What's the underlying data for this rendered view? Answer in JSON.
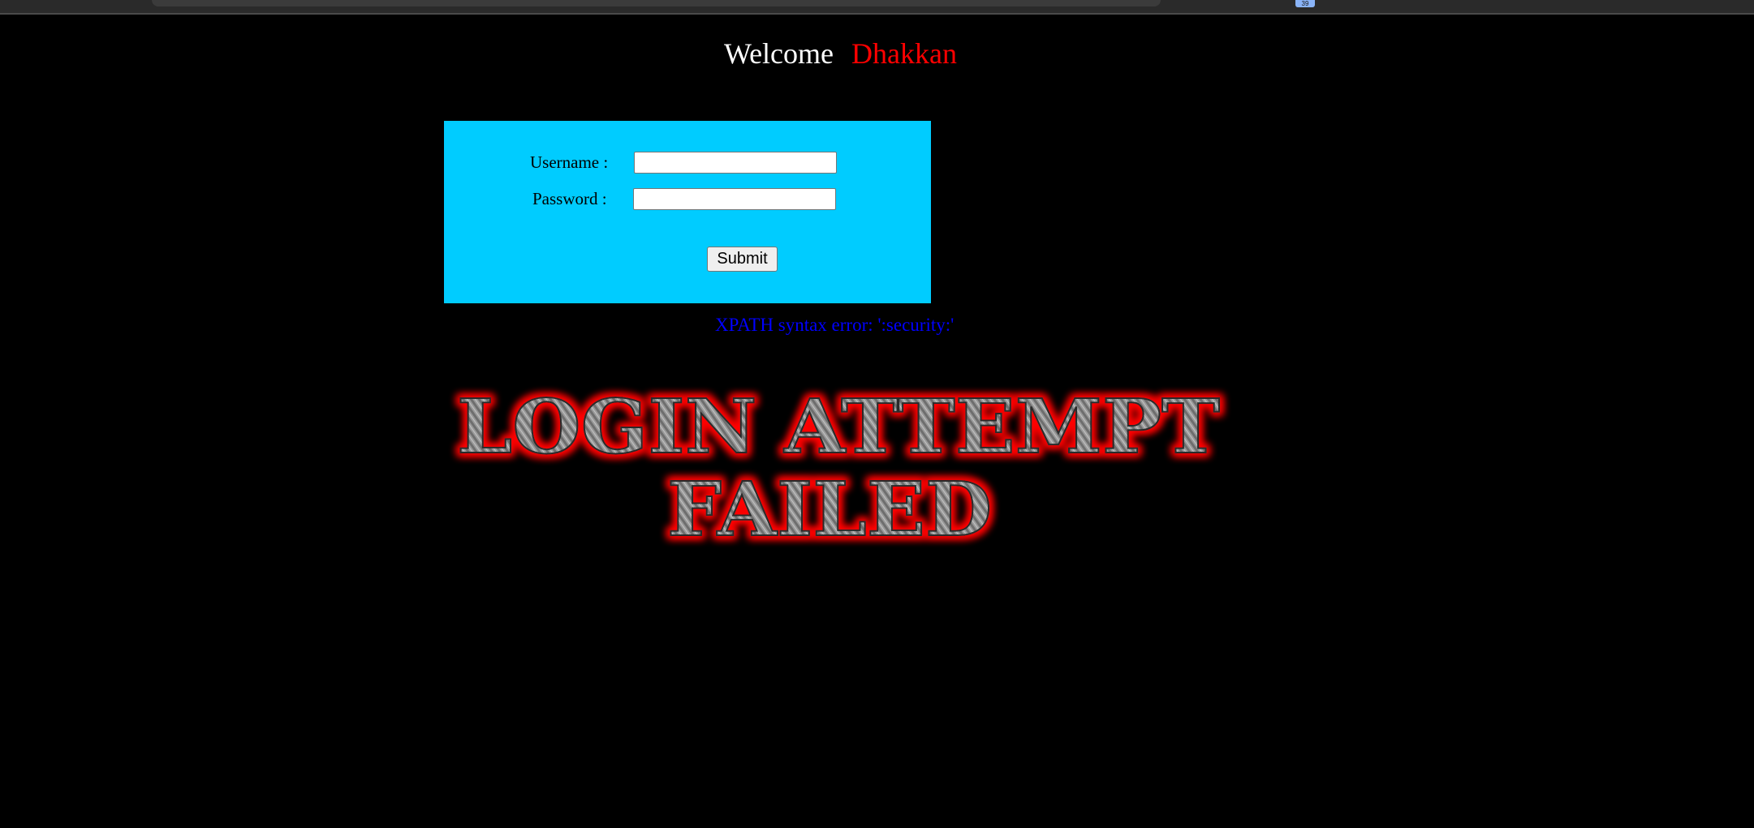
{
  "chrome": {
    "badge_text": "39"
  },
  "header": {
    "welcome_text": "Welcome",
    "name_text": "Dhakkan"
  },
  "form": {
    "username_label": "Username :",
    "username_value": "",
    "password_label": "Password :",
    "password_value": "",
    "submit_label": "Submit"
  },
  "error": {
    "message": "XPATH syntax error: ':security:'"
  },
  "banner": {
    "line1": "LOGIN ATTEMPT",
    "line2": "FAILED"
  },
  "colors": {
    "background": "#000000",
    "box": "#00ccff",
    "name": "#ff0000",
    "error": "#0000ff",
    "banner_glow": "#ff0000",
    "banner_fill": "#8a8a8a"
  }
}
